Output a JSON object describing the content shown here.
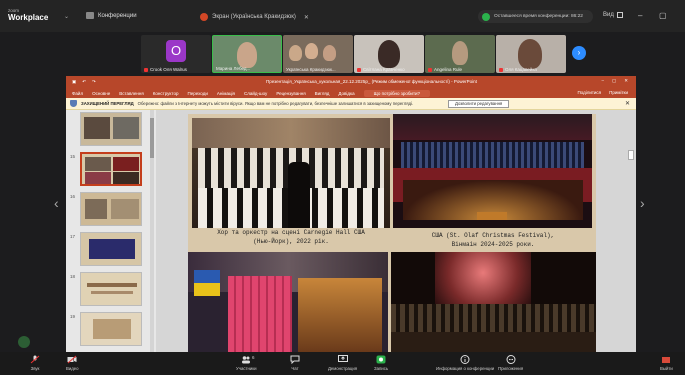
{
  "app": {
    "brand_small": "zoom",
    "brand_big": "Workplace",
    "conference_label": "Конференции",
    "meeting_tab": "Экран (Українська Кракидзюк)",
    "time_pill": "Оставшееся время конференции: 86:22",
    "view_label": "Вид"
  },
  "participants": [
    {
      "name": "Crook Оля Walrus"
    },
    {
      "name": "Марина Лебед..."
    },
    {
      "name": "Українська Кракидзюк..."
    },
    {
      "name": "Світлана Кравченко"
    },
    {
      "name": "Angelina Rule"
    },
    {
      "name": "Оля Кацавейка"
    }
  ],
  "avatar_letter": "O",
  "powerpoint": {
    "title": "Презентація_Українська_кукольная_22.12.2025р_ (Режим обмеженої функціональності) - PowerPoint",
    "ribbon_tabs": [
      "Файл",
      "Основне",
      "Вставлення",
      "Конструктор",
      "Переходи",
      "Анімація",
      "Слайд-шоу",
      "Рецензування",
      "Вигляд",
      "Довідка"
    ],
    "search_placeholder": "Що потрібно зробити?",
    "share_label": "Поділитися",
    "comments_label": "Примітки",
    "warning_bold": "ЗАХИЩЕНИЙ ПЕРЕГЛЯД",
    "warning_text": "Обережно: файли з Інтернету можуть містити віруси. Якщо вам не потрібно редагувати, безпечніше залишатися в захищеному перегляді.",
    "enable_edit": "Дозволити редагування",
    "thumb_numbers": [
      "",
      "15",
      "16",
      "17",
      "18",
      "19",
      ""
    ]
  },
  "slide": {
    "caption_left": "Хор та оркестр на сцені Carnegie Hall США (Нью-Йорк), 2022 рік.",
    "caption_right": "США (St. Olaf Christmas Festival), Вінмаін 2024-2025 роки."
  },
  "toolbar": {
    "mute_label": "Звук",
    "video_label": "Видео",
    "participants_label": "Участники",
    "chat_label": "Чат",
    "share_label": "Демонстрация",
    "record_label": "Запись",
    "reactions_label": "Реакции",
    "info_label": "Информация о конференции",
    "apps_label": "Приложения",
    "end_label": "Выйти",
    "participant_count": "6"
  }
}
